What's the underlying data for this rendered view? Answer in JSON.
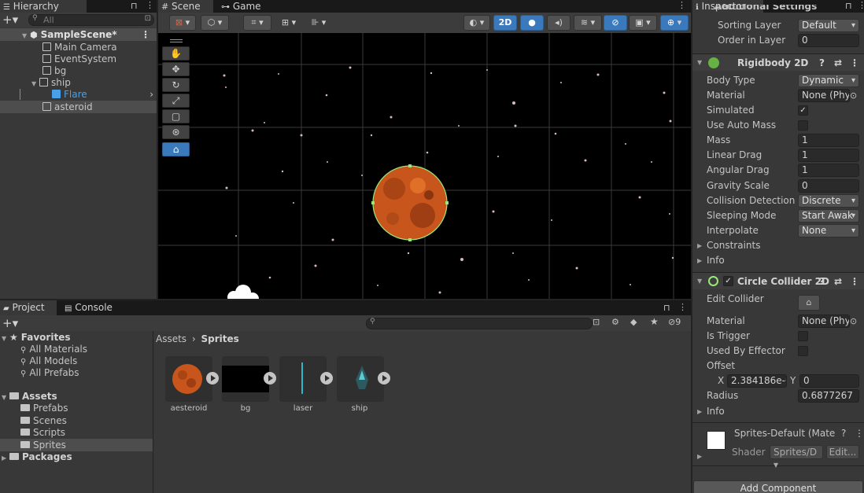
{
  "hierarchy": {
    "tab_label": "Hierarchy",
    "search_placeholder": "All",
    "items": [
      {
        "label": "SampleScene*"
      },
      {
        "label": "Main Camera"
      },
      {
        "label": "EventSystem"
      },
      {
        "label": "bg"
      },
      {
        "label": "ship"
      },
      {
        "label": "Flare"
      },
      {
        "label": "asteroid"
      }
    ]
  },
  "scene": {
    "tabs": [
      {
        "label": "Scene"
      },
      {
        "label": "Game"
      }
    ],
    "toolbar": {
      "mode_2d_label": "2D"
    },
    "tools": [
      "hand-tool",
      "move-tool",
      "rotate-tool",
      "scale-tool",
      "rect-tool",
      "transform-tool",
      "edit-collider-tool"
    ]
  },
  "project": {
    "tabs": [
      {
        "label": "Project"
      },
      {
        "label": "Console"
      }
    ],
    "hidden_count": "9",
    "favorites": {
      "label": "Favorites",
      "items": [
        {
          "label": "All Materials"
        },
        {
          "label": "All Models"
        },
        {
          "label": "All Prefabs"
        }
      ]
    },
    "assets": {
      "label": "Assets",
      "items": [
        {
          "label": "Prefabs"
        },
        {
          "label": "Scenes"
        },
        {
          "label": "Scripts"
        },
        {
          "label": "Sprites"
        }
      ]
    },
    "packages_label": "Packages",
    "breadcrumb": {
      "root": "Assets",
      "current": "Sprites"
    },
    "files": [
      {
        "label": "aesteroid"
      },
      {
        "label": "bg"
      },
      {
        "label": "laser"
      },
      {
        "label": "ship"
      }
    ]
  },
  "inspector": {
    "tab_label": "Inspector",
    "renderer": {
      "partial_header": "Additional Settings",
      "sorting_layer_label": "Sorting Layer",
      "sorting_layer_value": "Default",
      "order_label": "Order in Layer",
      "order_value": "0"
    },
    "rigidbody": {
      "title": "Rigidbody 2D",
      "rows": {
        "body_type": {
          "label": "Body Type",
          "value": "Dynamic"
        },
        "material": {
          "label": "Material",
          "value": "None (Phys"
        },
        "simulated": {
          "label": "Simulated",
          "checked": true
        },
        "auto_mass": {
          "label": "Use Auto Mass",
          "checked": false
        },
        "mass": {
          "label": "Mass",
          "value": "1"
        },
        "linear_drag": {
          "label": "Linear Drag",
          "value": "1"
        },
        "angular_drag": {
          "label": "Angular Drag",
          "value": "1"
        },
        "gravity_scale": {
          "label": "Gravity Scale",
          "value": "0"
        },
        "collision": {
          "label": "Collision Detection",
          "value": "Discrete"
        },
        "sleeping": {
          "label": "Sleeping Mode",
          "value": "Start Awak"
        },
        "interpolate": {
          "label": "Interpolate",
          "value": "None"
        }
      },
      "constraints_label": "Constraints",
      "info_label": "Info"
    },
    "collider": {
      "title": "Circle Collider 2D",
      "edit_collider_label": "Edit Collider",
      "material": {
        "label": "Material",
        "value": "None (Phys"
      },
      "is_trigger": {
        "label": "Is Trigger"
      },
      "effector": {
        "label": "Used By Effector"
      },
      "offset": {
        "label": "Offset",
        "x_label": "X",
        "x_value": "2.384186e-0",
        "y_label": "Y",
        "y_value": "0"
      },
      "radius": {
        "label": "Radius",
        "value": "0.6877267"
      },
      "info_label": "Info"
    },
    "material_block": {
      "name": "Sprites-Default (Mate",
      "shader_label": "Shader",
      "shader_value": "Sprites/D",
      "edit_label": "Edit..."
    },
    "add_component_label": "Add Component"
  }
}
